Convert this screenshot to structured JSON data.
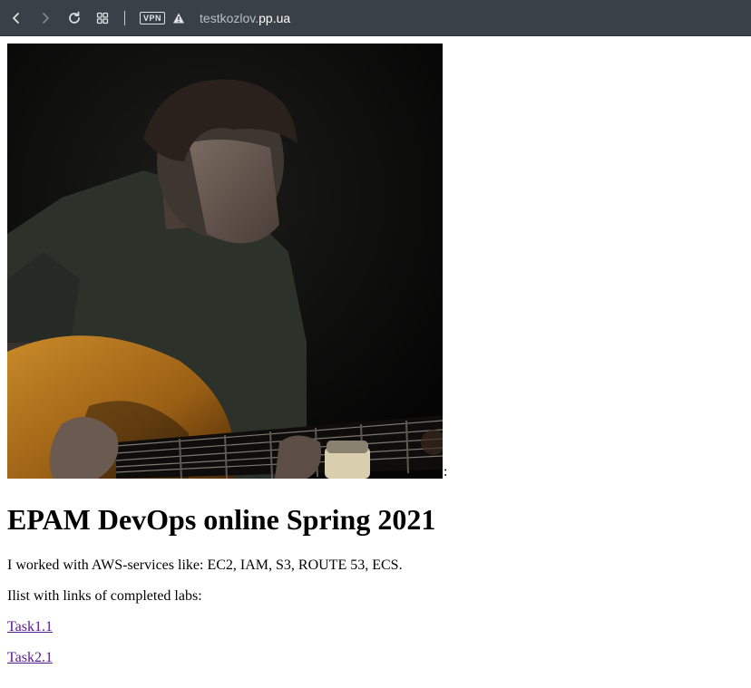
{
  "browser": {
    "vpn_label": "VPN",
    "url_prefix": "testkozlov.",
    "url_host": "pp.ua",
    "icons": [
      "back-icon",
      "forward-icon",
      "reload-icon",
      "tabs-grid-icon",
      "warning-icon"
    ]
  },
  "page": {
    "photo_separator": ":",
    "heading": "EPAM DevOps online Spring 2021",
    "paragraph1": "I worked with AWS-services like: EC2, IAM, S3, ROUTE 53, ECS.",
    "paragraph2": "Ilist with links of completed labs:",
    "links": [
      {
        "label": "Task1.1"
      },
      {
        "label": "Task2.1"
      }
    ],
    "link_color": "#551a8b"
  },
  "colors": {
    "toolbar_bg": "#3a4048",
    "page_bg": "#ffffff"
  }
}
